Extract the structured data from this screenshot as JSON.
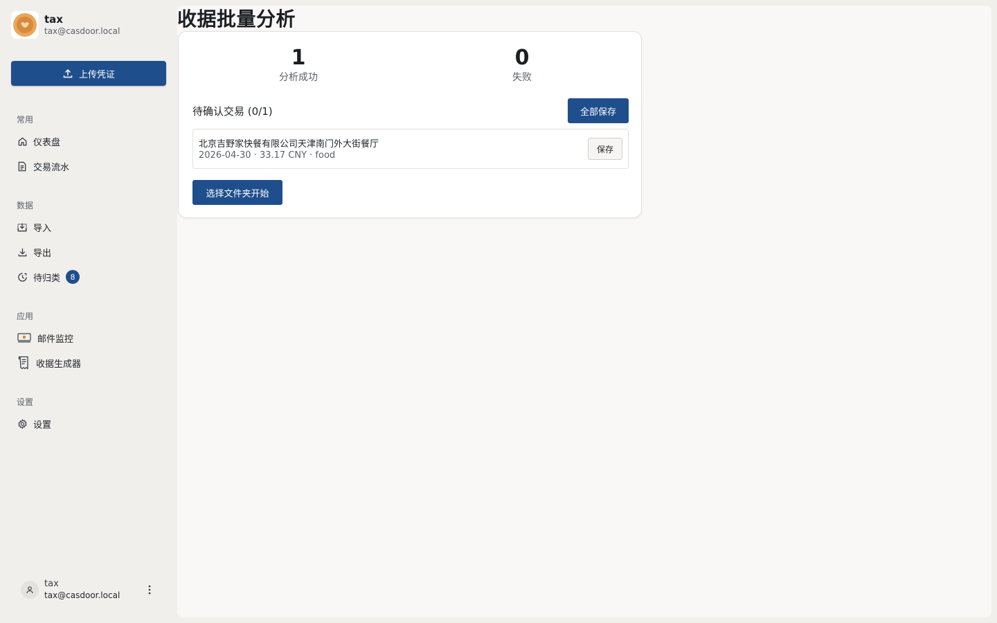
{
  "profile": {
    "name": "tax",
    "email": "tax@casdoor.local"
  },
  "upload_button": {
    "label": "上传凭证"
  },
  "sections": {
    "common": "常用",
    "data": "数据",
    "apps": "应用",
    "settings": "设置"
  },
  "nav": {
    "dashboard": "仪表盘",
    "transactions": "交易流水",
    "import": "导入",
    "export": "导出",
    "uncategorized": "待归类",
    "uncategorized_count": "8",
    "mail_monitor": "邮件监控",
    "receipt_generator": "收据生成器",
    "settings": "设置"
  },
  "footer_user": {
    "name": "tax",
    "email": "tax@casdoor.local"
  },
  "page": {
    "title": "收据批量分析"
  },
  "stats": {
    "success_value": "1",
    "success_label": "分析成功",
    "failed_value": "0",
    "failed_label": "失败"
  },
  "pending": {
    "title": "待确认交易 (0/1)",
    "save_all_label": "全部保存",
    "items": [
      {
        "merchant": "北京吉野家快餐有限公司天津南门外大街餐厅",
        "meta": "2026-04-30 · 33.17 CNY · food",
        "save_label": "保存"
      }
    ]
  },
  "start_button": {
    "label": "选择文件夹开始"
  },
  "colors": {
    "primary": "#1f4e8c",
    "background": "#f0efec",
    "card": "#ffffff"
  }
}
